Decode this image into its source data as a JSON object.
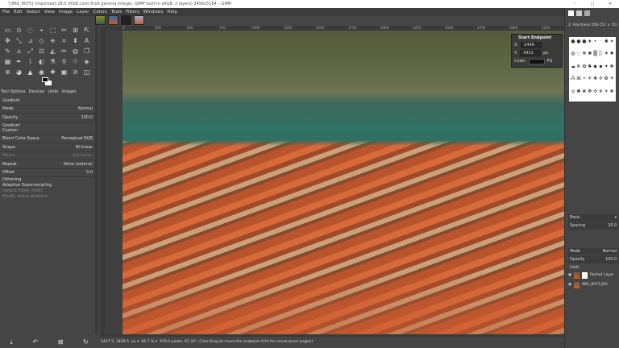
{
  "window": {
    "title": "*[IMG_8075] (imported)-28.0 (RGB color 8-bit gamma integer, GIMP built-in sRGB, 2 layers) 3456x5184 – GIMP",
    "controls": [
      "–",
      "□",
      "✕"
    ]
  },
  "menu": [
    "File",
    "Edit",
    "Select",
    "View",
    "Image",
    "Layer",
    "Colors",
    "Tools",
    "Filters",
    "Windows",
    "Help"
  ],
  "toolbox": {
    "tools": [
      "▭",
      "⊙",
      "◌",
      "⌖",
      "⬚",
      "✂",
      "⊞",
      "⇱",
      "✥",
      "⤡",
      "⊿",
      "◇",
      "⎈",
      "⌗",
      "⬍",
      "A",
      "✎",
      "⌂",
      "⤢",
      "⊡",
      "◭",
      "✏",
      "◍",
      "❐",
      "▦",
      "✒",
      "⌇",
      "◐",
      "⚗",
      "⚲",
      "☉",
      "◈",
      "⊛",
      "◕",
      "▲",
      "◉",
      "✚",
      "▣",
      "⊘",
      "◫"
    ],
    "dock_tabs": [
      "Tool Options",
      "Devices",
      "Undo",
      "Images"
    ],
    "options": {
      "title": "Gradient",
      "mode_label": "Mode",
      "mode_value": "Normal",
      "opacity_label": "Opacity",
      "opacity_value": "100.0",
      "gradient_label": "Gradient",
      "gradient_value": "Custom",
      "blend_label": "Blend Color Space",
      "blend_value": "Perceptual RGB",
      "shape_label": "Shape",
      "shape_value": "Bi-linear",
      "metric_label": "Metric",
      "metric_value": "Euclidean",
      "repeat_label": "Repeat",
      "repeat_value": "None (extend)",
      "offset_label": "Offset",
      "offset_value": "0.0",
      "dithering": "Dithering",
      "adaptive": "Adaptive Supersampling",
      "instant": "Instant mode (Shift)",
      "modify": "Modify active gradient"
    },
    "bottom_icons": [
      "⤓",
      "↶",
      "⊠",
      "↻"
    ]
  },
  "ruler": {
    "ticks": [
      "0",
      "250",
      "500",
      "750",
      "1000",
      "1250",
      "1500",
      "1750",
      "2000",
      "2250",
      "2500",
      "2750",
      "3000",
      "3250"
    ]
  },
  "endpoint": {
    "title": "Start Endpoint",
    "x_label": "X:",
    "x_value": "1449",
    "y_label": "Y:",
    "y_value": "3411",
    "unit": "px",
    "color_label": "Color:",
    "color_value": "FG"
  },
  "status": {
    "coords": "1447.5, 3409.5",
    "unit": "px",
    "zoom": "66.7 %",
    "message": "979.0 pixels, 97.34°, Click-Drag to move the endpoint (Ctrl for constrained angles)"
  },
  "dock": {
    "brushes_title": "2. Hardness 050 (51 × 51)",
    "brushes": [
      "●",
      "●",
      "●",
      "★",
      "•",
      "·",
      "✱",
      "✶",
      "◍",
      "◌",
      "❋",
      "✺",
      "▒",
      "░",
      "✷",
      "✹",
      "☁",
      "❄",
      "✿",
      "♣",
      "◆",
      "▪",
      "✦",
      "❖",
      "⁂",
      "⌘",
      "✧",
      "⚘",
      "✤",
      "✢",
      "❂",
      "✳",
      "◎",
      "✽",
      "❀",
      "✥",
      "✣",
      "✵",
      "✴",
      "❃"
    ],
    "preset": "Basic.",
    "spacing_label": "Spacing",
    "spacing_value": "10.0",
    "mode_label": "Mode",
    "mode_value": "Normal",
    "opacity_label": "Opacity",
    "opacity_value": "100.0",
    "lock_label": "Lock:",
    "layers": [
      "Pasted Layer",
      "IMG_8075.JPG"
    ]
  }
}
